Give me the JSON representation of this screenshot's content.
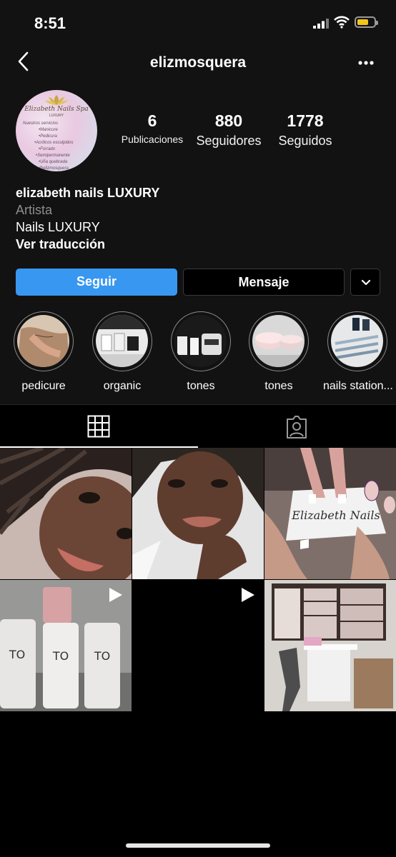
{
  "status_bar": {
    "time": "8:51",
    "battery_level": 0.7
  },
  "header": {
    "username": "elizmosquera"
  },
  "profile": {
    "avatar": {
      "brand": "Elizabeth Nails Spa",
      "brand_sub": "LUXURY",
      "services": [
        "Nuestros servicios",
        "•Manicure",
        "•Pedicura",
        "•Acrilicos esculpidos",
        "•Forrado",
        "•Semipermanente",
        "•Uña quebrada",
        "@elizmosquera"
      ]
    },
    "stats": [
      {
        "value": "6",
        "label": "Publicaciones"
      },
      {
        "value": "880",
        "label": "Seguidores"
      },
      {
        "value": "1778",
        "label": "Seguidos"
      }
    ],
    "bio": {
      "name": "elizabeth nails LUXURY",
      "category": "Artista",
      "text": "Nails LUXURY",
      "translate": "Ver traducción"
    },
    "buttons": {
      "follow": "Seguir",
      "message": "Mensaje"
    }
  },
  "highlights": [
    {
      "label": "pedicure"
    },
    {
      "label": "organic"
    },
    {
      "label": "tones"
    },
    {
      "label": "tones"
    },
    {
      "label": "nails station..."
    }
  ],
  "tabs": [
    {
      "name": "grid",
      "icon": "grid-icon",
      "active": true
    },
    {
      "name": "tagged",
      "icon": "tagged-person-icon",
      "active": false
    }
  ],
  "posts": [
    {
      "subject": "selfie-braids",
      "video": false
    },
    {
      "subject": "selfie-smile",
      "video": false
    },
    {
      "subject": "french-nails",
      "video": false
    },
    {
      "subject": "tones-gel-polish",
      "video": true
    },
    {
      "subject": "black-video",
      "video": true
    },
    {
      "subject": "nail-station",
      "video": false
    }
  ],
  "colors": {
    "follow_button": "#3897f0",
    "background": "#000000",
    "header": "#121212"
  }
}
